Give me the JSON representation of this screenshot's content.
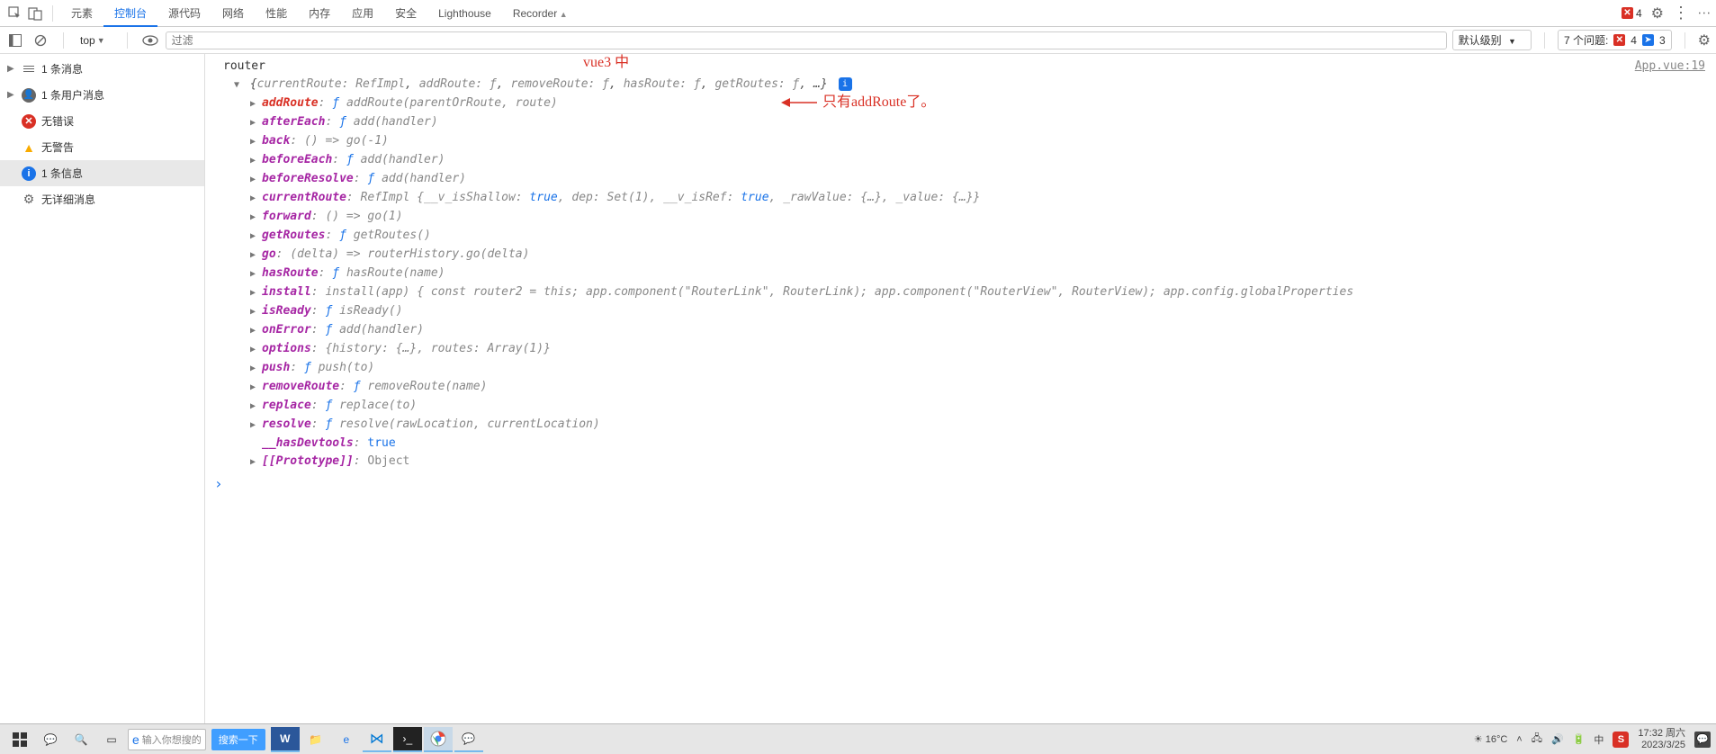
{
  "tabbar": {
    "tabs": [
      "元素",
      "控制台",
      "源代码",
      "网络",
      "性能",
      "内存",
      "应用",
      "安全",
      "Lighthouse",
      "Recorder"
    ],
    "active_index": 1,
    "error_count": "4"
  },
  "toolbar": {
    "context": "top",
    "filter_placeholder": "过滤",
    "level_label": "默认级别",
    "issues_label": "7 个问题:",
    "issues_err": "4",
    "issues_info": "3"
  },
  "sidebar": {
    "items": [
      {
        "icon": "lines",
        "label": "1 条消息",
        "expandable": true
      },
      {
        "icon": "user",
        "label": "1 条用户消息",
        "expandable": true
      },
      {
        "icon": "err",
        "label": "无错误",
        "expandable": false
      },
      {
        "icon": "warn",
        "label": "无警告",
        "expandable": false
      },
      {
        "icon": "info",
        "label": "1 条信息",
        "expandable": false,
        "selected": true
      },
      {
        "icon": "gear",
        "label": "无详细消息",
        "expandable": false
      }
    ]
  },
  "annotation": {
    "top": "vue3 中",
    "arrow": "只有addRoute了。"
  },
  "console": {
    "source_link": "App.vue:19",
    "root_label": "router",
    "summary_parts": [
      {
        "k": "currentRoute",
        "v": "RefImpl"
      },
      {
        "k": "addRoute",
        "v": "ƒ"
      },
      {
        "k": "removeRoute",
        "v": "ƒ"
      },
      {
        "k": "hasRoute",
        "v": "ƒ"
      },
      {
        "k": "getRoutes",
        "v": "ƒ"
      }
    ],
    "summary_trail": ", …}",
    "props": [
      {
        "key": "addRoute",
        "val": "ƒ addRoute(parentOrRoute, route)",
        "hl": true
      },
      {
        "key": "afterEach",
        "val": "ƒ add(handler)"
      },
      {
        "key": "back",
        "val": "() => go(-1)"
      },
      {
        "key": "beforeEach",
        "val": "ƒ add(handler)"
      },
      {
        "key": "beforeResolve",
        "val": "ƒ add(handler)"
      },
      {
        "key": "currentRoute",
        "raw": "RefImpl {__v_isShallow: <t>true</t>, dep: Set(1), __v_isRef: <t>true</t>, _rawValue: {…}, _value: {…}}"
      },
      {
        "key": "forward",
        "val": "() => go(1)"
      },
      {
        "key": "getRoutes",
        "val": "ƒ getRoutes()"
      },
      {
        "key": "go",
        "val": "(delta) => routerHistory.go(delta)"
      },
      {
        "key": "hasRoute",
        "val": "ƒ hasRoute(name)"
      },
      {
        "key": "install",
        "raw": "install(app) { const router2 = this; app.component(\"RouterLink\", RouterLink); app.component(\"RouterView\", RouterView); app.config.globalProperties"
      },
      {
        "key": "isReady",
        "val": "ƒ isReady()"
      },
      {
        "key": "onError",
        "val": "ƒ add(handler)"
      },
      {
        "key": "options",
        "raw": "{history: {…}, routes: Array(1)}"
      },
      {
        "key": "push",
        "val": "ƒ push(to)"
      },
      {
        "key": "removeRoute",
        "val": "ƒ removeRoute(name)"
      },
      {
        "key": "replace",
        "val": "ƒ replace(to)"
      },
      {
        "key": "resolve",
        "val": "ƒ resolve(rawLocation, currentLocation)"
      },
      {
        "key": "__hasDevtools",
        "plain": "true",
        "noexpand": true
      },
      {
        "key": "[[Prototype]]",
        "plain": "Object"
      }
    ]
  },
  "taskbar": {
    "search_placeholder": "输入你想搜的",
    "search_button": "搜索一下",
    "weather": "16°C",
    "time": "17:32",
    "day": "周六",
    "date": "2023/3/25"
  }
}
